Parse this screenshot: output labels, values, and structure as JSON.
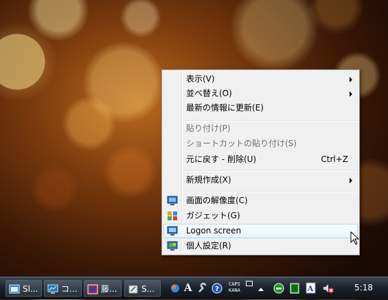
{
  "context_menu": {
    "items": [
      {
        "label": "表示(V)",
        "submenu": true
      },
      {
        "label": "並べ替え(O)",
        "submenu": true
      },
      {
        "label": "最新の情報に更新(E)"
      },
      {
        "label": "貼り付け(P)",
        "disabled": true
      },
      {
        "label": "ショートカットの貼り付け(S)",
        "disabled": true
      },
      {
        "label": "元に戻す - 削除(U)",
        "shortcut": "Ctrl+Z"
      },
      {
        "label": "新規作成(X)",
        "submenu": true
      },
      {
        "label": "画面の解像度(C)",
        "icon": "monitor-resolution-icon"
      },
      {
        "label": "ガジェット(G)",
        "icon": "gadgets-icon"
      },
      {
        "label": "Logon screen",
        "icon": "logon-screen-icon",
        "highlighted": true
      },
      {
        "label": "個人設定(R)",
        "icon": "personalize-icon"
      }
    ]
  },
  "taskbar": {
    "buttons": [
      {
        "label": "Sl...",
        "icon": "app-window-icon"
      },
      {
        "label": "コ...",
        "icon": "control-panel-icon"
      },
      {
        "label": "藤...",
        "icon": "app-icon"
      },
      {
        "label": "S...",
        "icon": "folder-icon"
      }
    ],
    "tray": {
      "caps_label": "CAPS",
      "kana_label": "KANA",
      "clock": "5:18"
    }
  }
}
